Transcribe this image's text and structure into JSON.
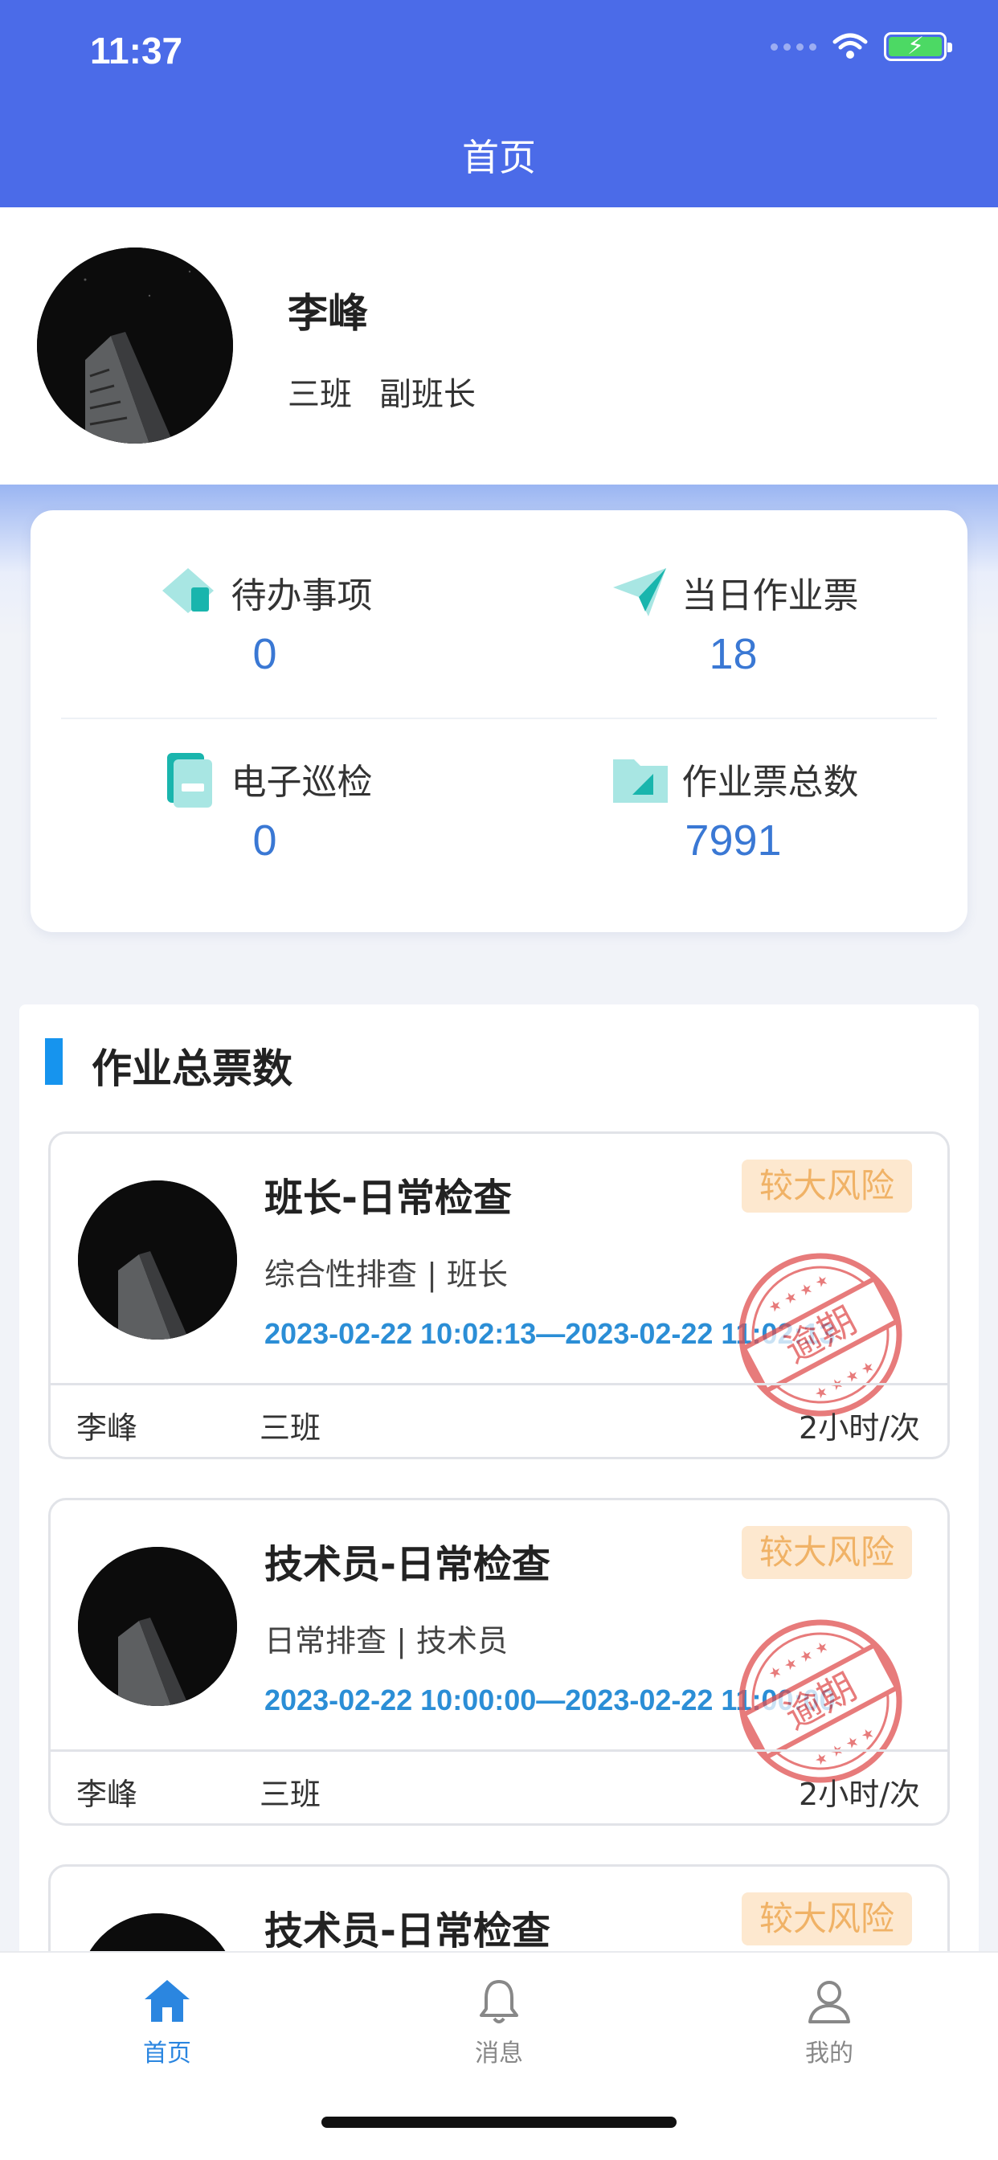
{
  "status_bar": {
    "time": "11:37"
  },
  "header": {
    "title": "首页"
  },
  "profile": {
    "name": "李峰",
    "team": "三班",
    "position": "副班长"
  },
  "stats": [
    {
      "label": "待办事项",
      "value": "0",
      "icon": "todo-icon"
    },
    {
      "label": "当日作业票",
      "value": "18",
      "icon": "paper-plane-icon"
    },
    {
      "label": "电子巡检",
      "value": "0",
      "icon": "inspection-doc-icon"
    },
    {
      "label": "作业票总数",
      "value": "7991",
      "icon": "folder-icon"
    }
  ],
  "section": {
    "title": "作业总票数"
  },
  "tickets": [
    {
      "title": "班长-日常检查",
      "subtitle": "综合性排查 | 班长",
      "time_range": "2023-02-22 10:02:13—2023-02-22 11:02:13",
      "risk": "较大风险",
      "stamp": "逾期",
      "name": "李峰",
      "team": "三班",
      "frequency": "2小时/次"
    },
    {
      "title": "技术员-日常检查",
      "subtitle": "日常排查 | 技术员",
      "time_range": "2023-02-22 10:00:00—2023-02-22 11:00:00",
      "risk": "较大风险",
      "stamp": "逾期",
      "name": "李峰",
      "team": "三班",
      "frequency": "2小时/次"
    },
    {
      "title": "技术员-日常检查",
      "risk": "较大风险"
    }
  ],
  "tabbar": [
    {
      "label": "首页",
      "icon": "home-icon",
      "active": true
    },
    {
      "label": "消息",
      "icon": "bell-icon",
      "active": false
    },
    {
      "label": "我的",
      "icon": "user-icon",
      "active": false
    }
  ],
  "colors": {
    "header": "#4b6be8",
    "accent": "#2b86e0",
    "stat_value": "#3a78d4",
    "risk_bg": "#fde8cf",
    "risk_text": "#f0b266",
    "stamp": "#e05050"
  }
}
